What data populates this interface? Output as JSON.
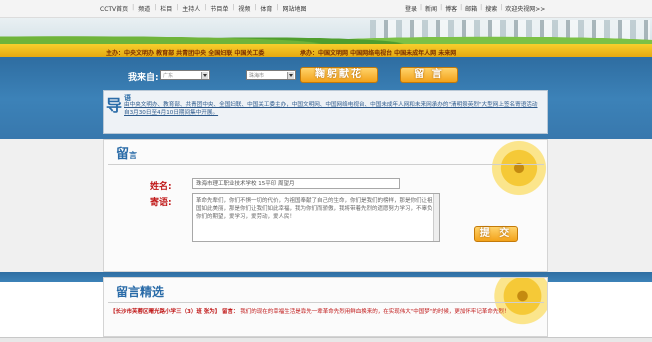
{
  "topnav": {
    "left_links": [
      "CCTV首页",
      "|",
      "频道",
      "|",
      "栏目",
      "|",
      "主持人",
      "|",
      "节目单",
      "|",
      "视频",
      "|",
      "体育",
      "|",
      "网站地图"
    ],
    "right_links": [
      "登录",
      "|",
      "新闻",
      "|",
      "博客",
      "|",
      "邮箱",
      "|",
      "搜索",
      "|",
      "欢迎央视网>>"
    ]
  },
  "sponsor": {
    "host_text": "主办：中央文明办 教育部 共青团中央 全国妇联 中国关工委",
    "organizer_text": "承办：中国文明网 中国网络电视台 中国未成年人网 未来网"
  },
  "header": {
    "from_label": "我来自:",
    "province_select": "广东",
    "city_select": "珠海市",
    "tribute_button": "鞠躬献花",
    "message_button": "留 言"
  },
  "guide": {
    "title_big": "导",
    "title_small": "语",
    "text": "由中央文明办、教育部、共青团中央、全国妇联、中国关工委主办，中国文明网、中国网络电视台、中国未成年人网和未来网承办的\"清明祭英烈\"大型网上签名寄语活动自3月30日至4月10日期间集中开展。"
  },
  "message": {
    "title_big": "留",
    "title_small": "言",
    "name_label": "姓名:",
    "name_value": "珠海市理工职业技术学校  15平印  周望月",
    "message_label": "寄语:",
    "message_value": "革命先辈们，你们不惧一切的代价，为祖国奉献了自己的生命，你们是我们的榜样，那是你们让祖国如此美丽，那是你们让我们如此幸福，我为你们而骄傲，我将带着先烈的遗愿努力学习，不辜负你们的期望，爱学习，爱劳动，爱人民！",
    "submit_button": "提 交"
  },
  "selected": {
    "title": "留言精选",
    "entry_who": "【长沙市芙蓉区曙光路小学三（3）班  张为】",
    "entry_tag": "留言：",
    "entry_body": "我们的现在的幸福生活是靠先一辈革命先烈用鲜血换来的，在实现伟大\"中国梦\"的时候，更加怀牢记革命先烈！"
  },
  "colors": {
    "accent_blue": "#2b6ca8",
    "label_red": "#c01818",
    "button_orange": "#f3a21a",
    "sponsor_yellow": "#f8cf2c"
  }
}
